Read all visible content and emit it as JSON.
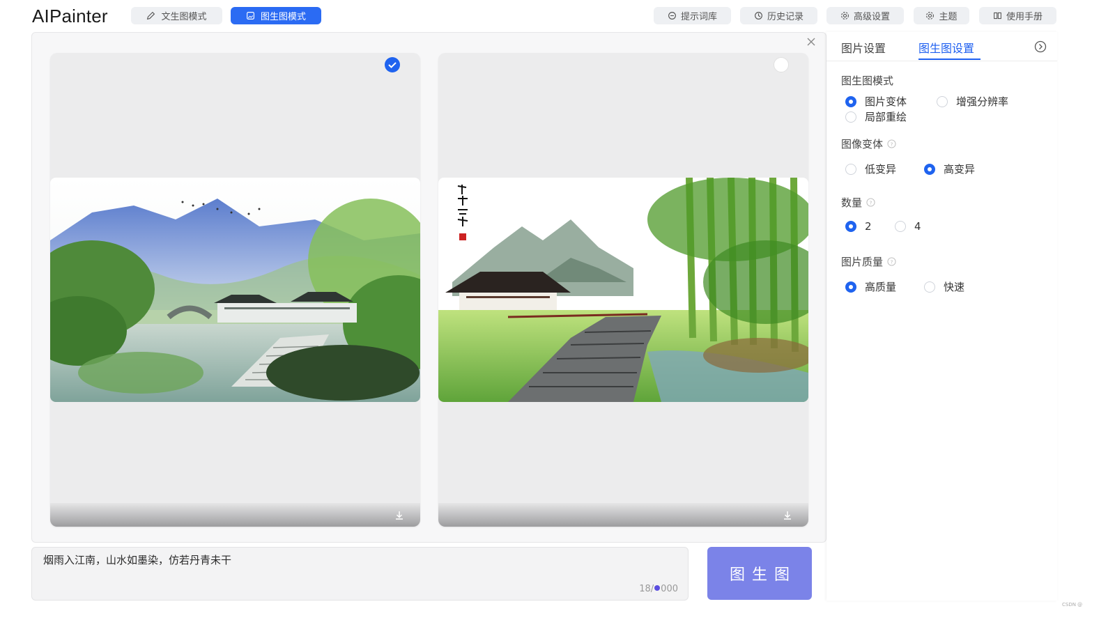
{
  "app": {
    "title": "AIPainter"
  },
  "modes": [
    {
      "label": "文生图模式",
      "active": false,
      "icon": "pencil-icon"
    },
    {
      "label": "图生图模式",
      "active": true,
      "icon": "image-icon"
    }
  ],
  "nav": [
    {
      "label": "提示词库",
      "icon": "prompt-icon"
    },
    {
      "label": "历史记录",
      "icon": "history-icon"
    },
    {
      "label": "高级设置",
      "icon": "settings-icon"
    },
    {
      "label": "主题",
      "icon": "theme-icon"
    },
    {
      "label": "使用手册",
      "icon": "book-icon"
    }
  ],
  "gallery": {
    "images": [
      {
        "description_icon": "landscape-image",
        "selected": true
      },
      {
        "description_icon": "landscape-image",
        "selected": false,
        "seal_text": "烟雨入江南"
      }
    ]
  },
  "prompt": {
    "value": "烟雨入江南，山水如墨染，仿若丹青未干",
    "count": "18",
    "max_suffix": "000"
  },
  "generate_button": {
    "label": "图生图"
  },
  "panel": {
    "tabs": [
      {
        "label": "图片设置",
        "active": false
      },
      {
        "label": "图生图设置",
        "active": true
      }
    ],
    "sections": {
      "mode": {
        "label": "图生图模式",
        "options": [
          "图片变体",
          "增强分辨率",
          "局部重绘"
        ],
        "selected": "图片变体"
      },
      "variation": {
        "label": "图像变体",
        "options": [
          "低变异",
          "高变异"
        ],
        "selected": "高变异"
      },
      "count": {
        "label": "数量",
        "options": [
          "2",
          "4"
        ],
        "selected": "2"
      },
      "quality": {
        "label": "图片质量",
        "options": [
          "高质量",
          "快速"
        ],
        "selected": "高质量"
      }
    }
  },
  "colors": {
    "accent": "#1f63ef",
    "generate": "#7b83e8"
  },
  "footer": {
    "watermark": "CSDN @"
  }
}
